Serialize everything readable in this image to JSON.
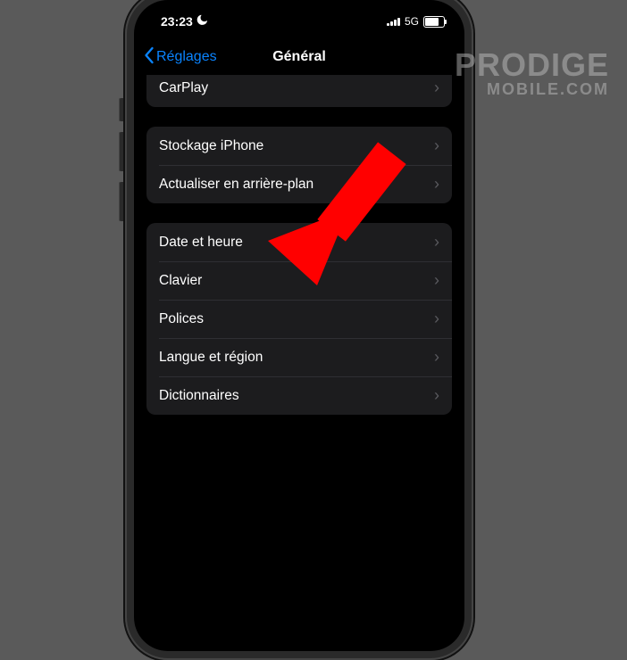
{
  "status": {
    "time": "23:23",
    "network": "5G"
  },
  "nav": {
    "back_label": "Réglages",
    "title": "Général"
  },
  "group0": {
    "carplay": "CarPlay"
  },
  "group1": {
    "storage": "Stockage iPhone",
    "background_refresh": "Actualiser en arrière-plan"
  },
  "group2": {
    "date_time": "Date et heure",
    "keyboard": "Clavier",
    "fonts": "Polices",
    "language_region": "Langue et région",
    "dictionaries": "Dictionnaires"
  },
  "watermark": {
    "line1": "PRODIGE",
    "line2": "MOBILE.COM"
  }
}
